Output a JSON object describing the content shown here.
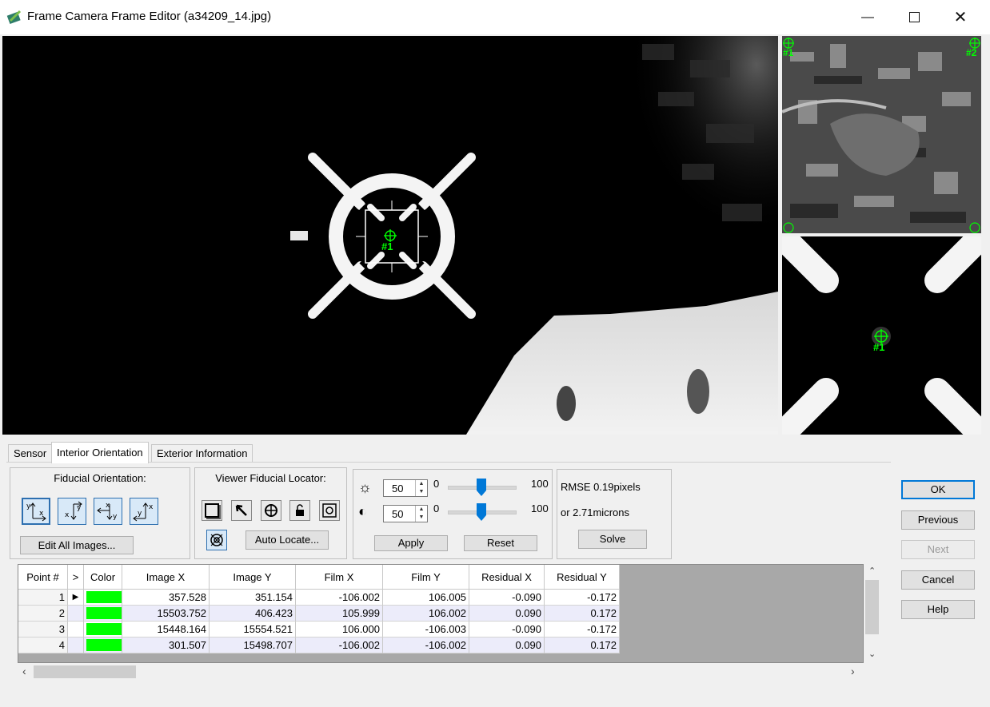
{
  "window": {
    "title": "Frame Camera Frame Editor (a34209_14.jpg)",
    "accent_icon_color": "#2e7d32"
  },
  "viewer": {
    "main_marker": "#1",
    "zoom_marker": "#1",
    "overview_markers": [
      "#1",
      "#2"
    ]
  },
  "tabs": [
    {
      "label": "Sensor",
      "active": false
    },
    {
      "label": "Interior Orientation",
      "active": true
    },
    {
      "label": "Exterior Information",
      "active": false
    }
  ],
  "fiducial_orientation": {
    "label": "Fiducial Orientation:",
    "edit_all_label": "Edit All Images..."
  },
  "locator": {
    "label": "Viewer Fiducial Locator:",
    "auto_locate_label": "Auto Locate..."
  },
  "adjust": {
    "brightness": {
      "value": "50",
      "min": "0",
      "max": "100"
    },
    "contrast": {
      "value": "50",
      "min": "0",
      "max": "100"
    },
    "apply_label": "Apply",
    "reset_label": "Reset"
  },
  "rmse": {
    "pixels_text": "RMSE 0.19pixels",
    "microns_text": "or 2.71microns",
    "solve_label": "Solve"
  },
  "buttons": {
    "ok": "OK",
    "previous": "Previous",
    "next": "Next",
    "cancel": "Cancel",
    "help": "Help"
  },
  "table": {
    "headers": [
      "Point #",
      ">",
      "Color",
      "Image X",
      "Image Y",
      "Film X",
      "Film Y",
      "Residual X",
      "Residual Y"
    ],
    "rows": [
      [
        "1",
        "",
        "#00ff00",
        "357.528",
        "351.154",
        "-106.002",
        "106.005",
        "-0.090",
        "-0.172"
      ],
      [
        "2",
        "",
        "#00ff00",
        "15503.752",
        "406.423",
        "105.999",
        "106.002",
        "0.090",
        "0.172"
      ],
      [
        "3",
        "",
        "#00ff00",
        "15448.164",
        "15554.521",
        "106.000",
        "-106.003",
        "-0.090",
        "-0.172"
      ],
      [
        "4",
        "",
        "#00ff00",
        "301.507",
        "15498.707",
        "-106.002",
        "-106.002",
        "0.090",
        "0.172"
      ]
    ],
    "current_row_indicator": "▶"
  }
}
